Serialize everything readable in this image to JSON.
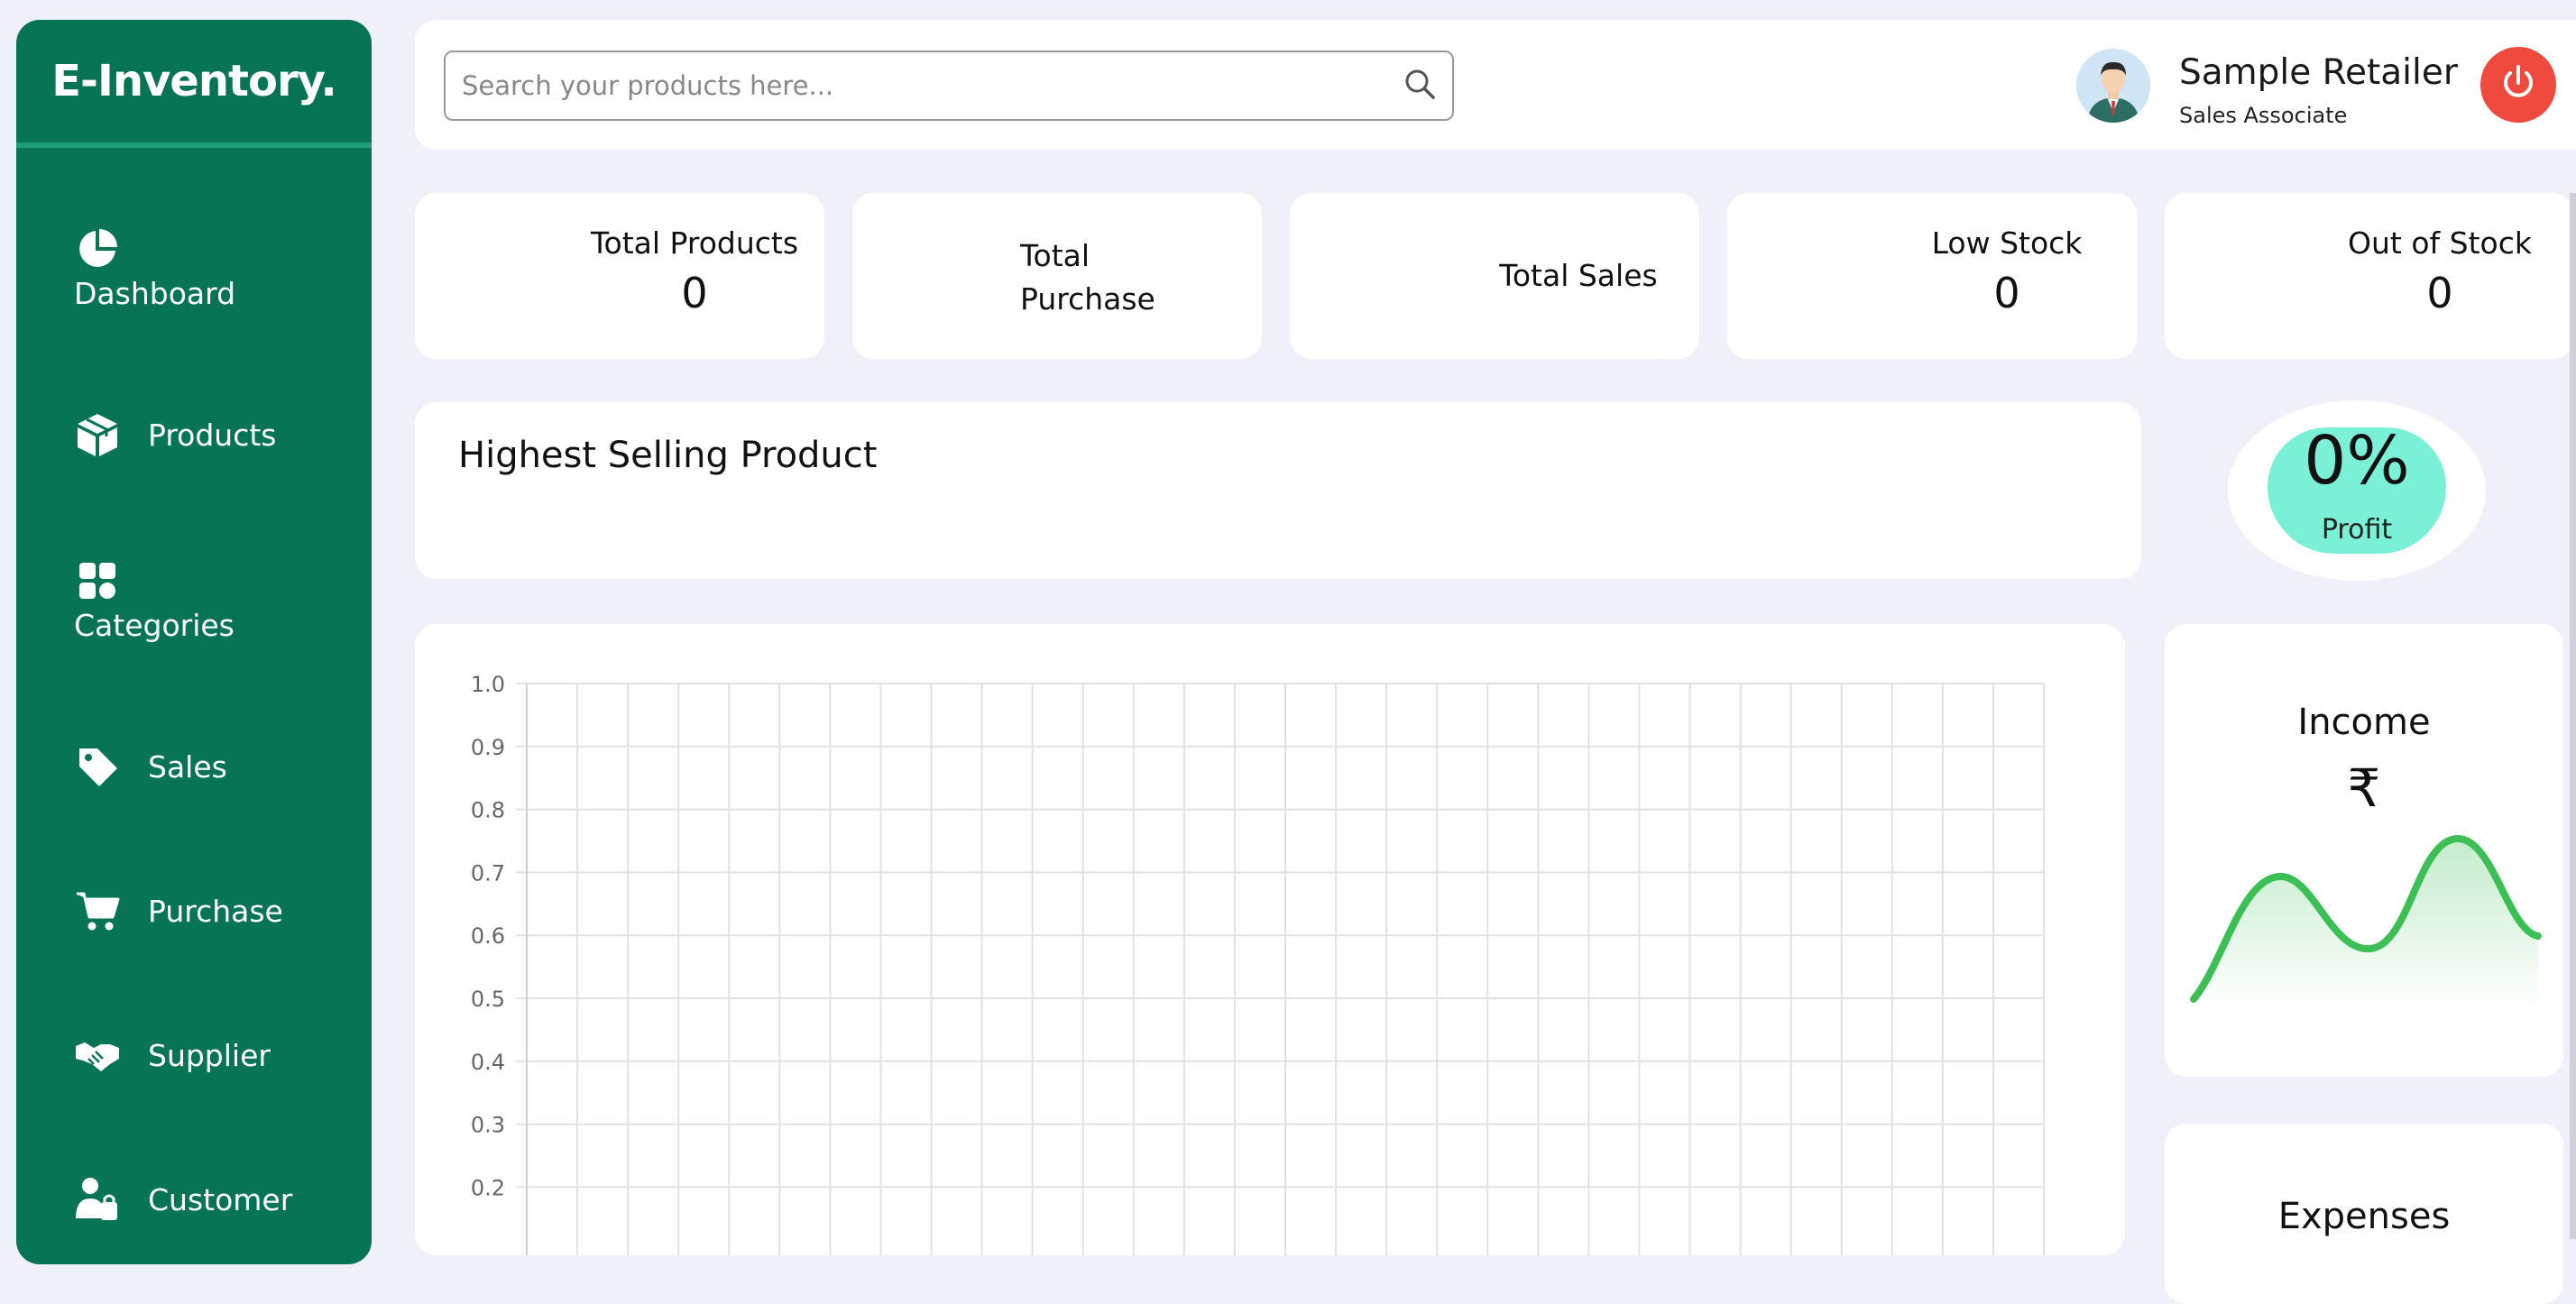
{
  "brand": {
    "name": "E-Inventory."
  },
  "sidebar": {
    "items": [
      {
        "label": "Dashboard",
        "icon": "pie-chart-icon"
      },
      {
        "label": "Products",
        "icon": "box-icon"
      },
      {
        "label": "Categories",
        "icon": "grid-icon"
      },
      {
        "label": "Sales",
        "icon": "tag-icon"
      },
      {
        "label": "Purchase",
        "icon": "cart-icon"
      },
      {
        "label": "Supplier",
        "icon": "handshake-icon"
      },
      {
        "label": "Customer",
        "icon": "customer-icon"
      }
    ]
  },
  "search": {
    "placeholder": "Search your products here..."
  },
  "user": {
    "name": "Sample Retailer",
    "role": "Sales Associate"
  },
  "stats": [
    {
      "label": "Total Products",
      "value": "0"
    },
    {
      "label": "Total Purchase",
      "value": ""
    },
    {
      "label": "Total Sales",
      "value": ""
    },
    {
      "label": "Low Stock",
      "value": "0"
    },
    {
      "label": "Out of Stock",
      "value": "0"
    }
  ],
  "highest_selling": {
    "title": "Highest Selling Product"
  },
  "profit": {
    "value": "0%",
    "label": "Profit"
  },
  "income": {
    "title": "Income",
    "symbol": "₹"
  },
  "expenses": {
    "title": "Expenses"
  },
  "chart_data": {
    "type": "line",
    "title": "",
    "xlabel": "",
    "ylabel": "",
    "ylim": [
      0,
      1.0
    ],
    "y_ticks": [
      "1.0",
      "0.9",
      "0.8",
      "0.7",
      "0.6",
      "0.5",
      "0.4",
      "0.3",
      "0.2"
    ],
    "x_gridlines": 30,
    "series": [],
    "grid": true
  },
  "colors": {
    "sidebar": "#077453",
    "background": "#f0f0fb",
    "power": "#f04a3e",
    "profit": "#7af0d6",
    "income_line": "#3cbf55"
  }
}
